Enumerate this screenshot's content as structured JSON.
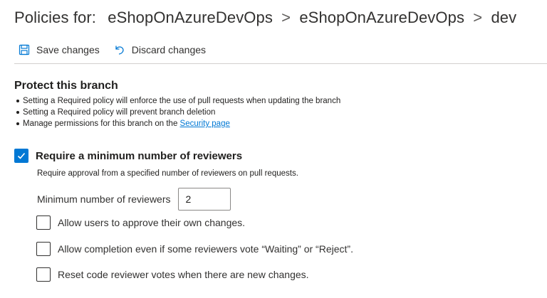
{
  "header": {
    "label": "Policies for:",
    "breadcrumb": [
      "eShopOnAzureDevOps",
      "eShopOnAzureDevOps",
      "dev"
    ],
    "separator": ">"
  },
  "toolbar": {
    "save_label": "Save changes",
    "save_icon": "save-icon",
    "discard_label": "Discard changes",
    "discard_icon": "undo-icon"
  },
  "protect": {
    "title": "Protect this branch",
    "bullets": [
      "Setting a Required policy will enforce the use of pull requests when updating the branch",
      "Setting a Required policy will prevent branch deletion"
    ],
    "permissions_prefix": "Manage permissions for this branch on the",
    "permissions_link": "Security page"
  },
  "policy": {
    "title": "Require a minimum number of reviewers",
    "checked": true,
    "description": "Require approval from a specified number of reviewers on pull requests.",
    "min_label": "Minimum number of reviewers",
    "min_value": "2",
    "options": [
      {
        "label": "Allow users to approve their own changes.",
        "checked": false
      },
      {
        "label": "Allow completion even if some reviewers vote “Waiting” or “Reject”.",
        "checked": false
      },
      {
        "label": "Reset code reviewer votes when there are new changes.",
        "checked": false
      }
    ]
  },
  "colors": {
    "accent": "#0078d4",
    "text": "#201f1e",
    "divider": "#d2d0ce"
  }
}
